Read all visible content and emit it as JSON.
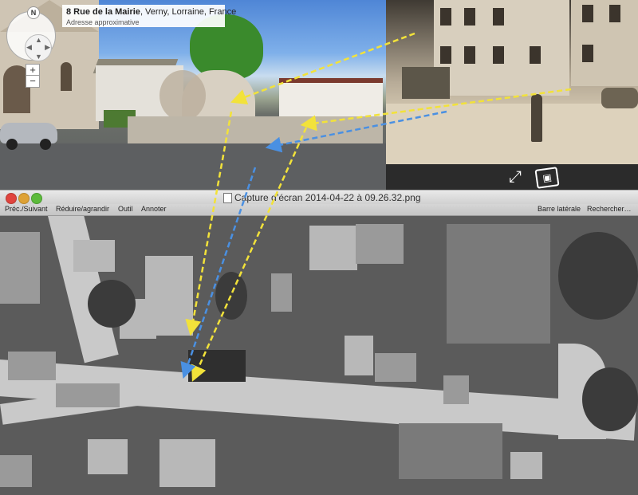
{
  "streetview": {
    "address_street": "8 Rue de la Mairie",
    "address_rest": ", Verny, Lorraine, France",
    "address_note": "Adresse approximative",
    "compass_label": "N",
    "zoom_in": "+",
    "zoom_out": "−"
  },
  "oldphoto": {
    "expand_icon": "expand-arrows-icon",
    "photo_icon": "photo-icon"
  },
  "window": {
    "title": "Capture d’écran 2014-04-22 à 09.26.32.png",
    "toolbar": {
      "prev_next": "Préc./Suivant",
      "zoom": "Réduire/agrandir",
      "tool": "Outil",
      "annotate": "Annoter",
      "sidebar": "Barre latérale",
      "search": "Rechercher…"
    }
  },
  "colors": {
    "arrow_yellow": "#f2e23a",
    "arrow_blue": "#4a90e2"
  }
}
